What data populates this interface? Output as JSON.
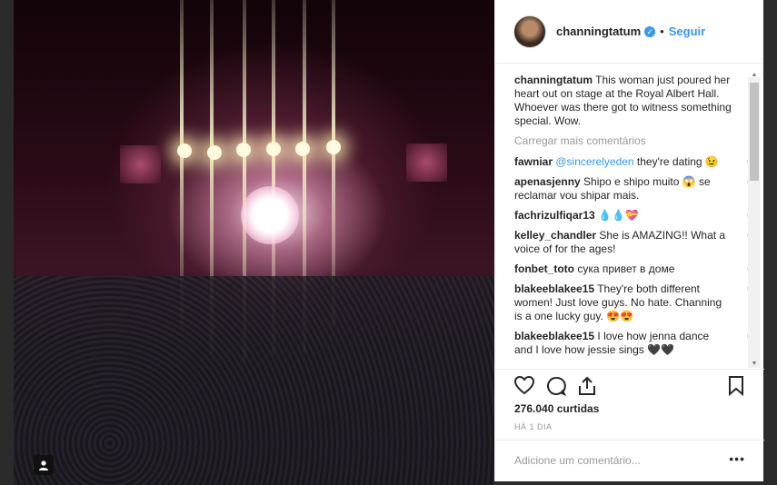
{
  "post": {
    "username": "channingtatum",
    "follow_label": "Seguir",
    "separator": "•",
    "caption_user": "channingtatum",
    "caption_text": " This woman just poured her heart out on stage at the Royal Albert Hall. Whoever was there got to witness something special. Wow.",
    "load_more": "Carregar mais comentários",
    "comments": [
      {
        "user": "fawniar",
        "mention": "@sincerelyeden",
        "text": " they're dating 😉"
      },
      {
        "user": "apenasjenny",
        "mention": "",
        "text": " Shipo e shipo muito 😱 se reclamar vou shipar mais."
      },
      {
        "user": "fachrizulfiqar13",
        "mention": "",
        "text": " 💧💧💝"
      },
      {
        "user": "kelley_chandler",
        "mention": "",
        "text": " She is AMAZING!! What a voice of for the ages!"
      },
      {
        "user": "fonbet_toto",
        "mention": "",
        "text": " сука привет в доме"
      },
      {
        "user": "blakeeblakee15",
        "mention": "",
        "text": " They're both different women! Just love guys. No hate. Channing is a one lucky guy. 😍😍"
      },
      {
        "user": "blakeeblakee15",
        "mention": "",
        "text": " I love how jenna dance and I love how jessie sings 🖤🖤"
      }
    ],
    "likes": "276.040 curtidas",
    "time": "HÁ 1 DIA",
    "add_comment_placeholder": "Adicione um comentário...",
    "options": "•••"
  },
  "icons": {
    "heart": "heart-icon",
    "comment": "comment-icon",
    "share": "share-icon",
    "bookmark": "bookmark-icon",
    "verified": "verified-badge-icon",
    "user": "user-tag-icon"
  }
}
